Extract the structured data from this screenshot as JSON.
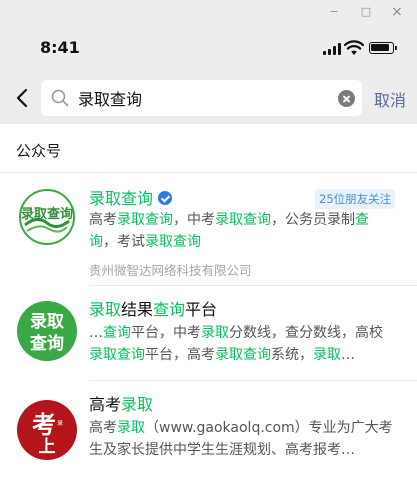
{
  "window_controls": {
    "minimize": "−",
    "maximize": "□",
    "close": "×"
  },
  "status_bar": {
    "time": "8:41"
  },
  "search": {
    "query": "录取查询",
    "cancel_label": "取消"
  },
  "section": {
    "title": "公众号"
  },
  "results": [
    {
      "name_parts": [
        "录取查询",
        "",
        ""
      ],
      "friends_badge": "25位朋友关注",
      "desc_parts": [
        "高考",
        "录取查询",
        "，中考",
        "录取查询",
        "，公务员录制",
        "查询",
        "，考试",
        "录取查询"
      ],
      "company": "贵州微智达网络科技有限公司",
      "avatar": {
        "text": "录取查询",
        "colors": [
          "#2f8f3a",
          "#3aa845"
        ]
      }
    },
    {
      "name_parts": [
        "录取",
        "结果",
        "查询",
        "平台"
      ],
      "desc_parts": [
        "…",
        "查询",
        "平台，中考",
        "录取",
        "分数线，查分数线，高校",
        "录取查询",
        "平台，高考",
        "录取查询",
        "系统，",
        "录取",
        "…"
      ],
      "avatar": {
        "line1": "录取",
        "line2": "查询",
        "color": "#3aa845"
      }
    },
    {
      "name_parts": [
        "高考",
        "录取"
      ],
      "desc_parts": [
        "高考",
        "录取",
        "（www.gaokaolq.com）专业为广大考生及家长提供中学生生涯规划、高考报考…"
      ],
      "avatar": {
        "big": "考",
        "small": "上",
        "tiny": "录",
        "color": "#b3151b"
      }
    }
  ]
}
